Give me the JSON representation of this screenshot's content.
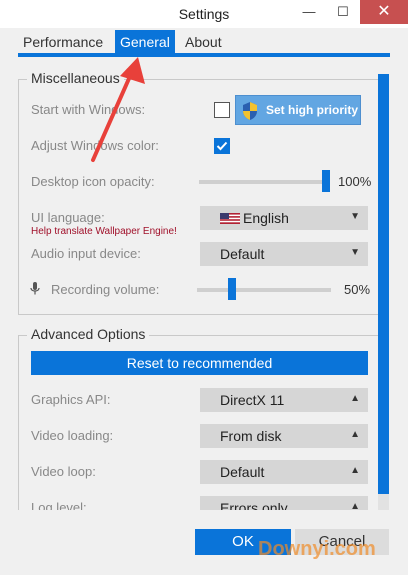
{
  "window": {
    "title": "Settings",
    "min_glyph": "—",
    "max_glyph": "☐",
    "close_glyph": "✕"
  },
  "tabs": [
    {
      "label": "Performance",
      "active": false
    },
    {
      "label": "General",
      "active": true
    },
    {
      "label": "About",
      "active": false
    }
  ],
  "misc": {
    "title": "Miscellaneous",
    "start_with_windows": {
      "label": "Start with Windows:",
      "checked": false
    },
    "priority_button": "Set high priority",
    "adjust_color": {
      "label": "Adjust Windows color:",
      "checked": true
    },
    "desktop_opacity": {
      "label": "Desktop icon opacity:",
      "value": "100%"
    },
    "ui_language": {
      "label": "UI language:",
      "value": "English",
      "help_link": "Help translate Wallpaper Engine!"
    },
    "audio_input": {
      "label": "Audio input device:",
      "value": "Default"
    },
    "recording_volume": {
      "label": "Recording volume:",
      "value": "50%"
    }
  },
  "advanced": {
    "title": "Advanced Options",
    "reset_button": "Reset to recommended",
    "graphics_api": {
      "label": "Graphics API:",
      "value": "DirectX 11"
    },
    "video_loading": {
      "label": "Video loading:",
      "value": "From disk"
    },
    "video_loop": {
      "label": "Video loop:",
      "value": "Default"
    },
    "log_level": {
      "label": "Log level:",
      "value": "Errors only"
    }
  },
  "footer": {
    "ok": "OK",
    "cancel": "Cancel"
  },
  "watermark": "Downyi.com",
  "colors": {
    "accent": "#0a74d9",
    "link": "#a0102a",
    "annotation": "#e8403a"
  }
}
